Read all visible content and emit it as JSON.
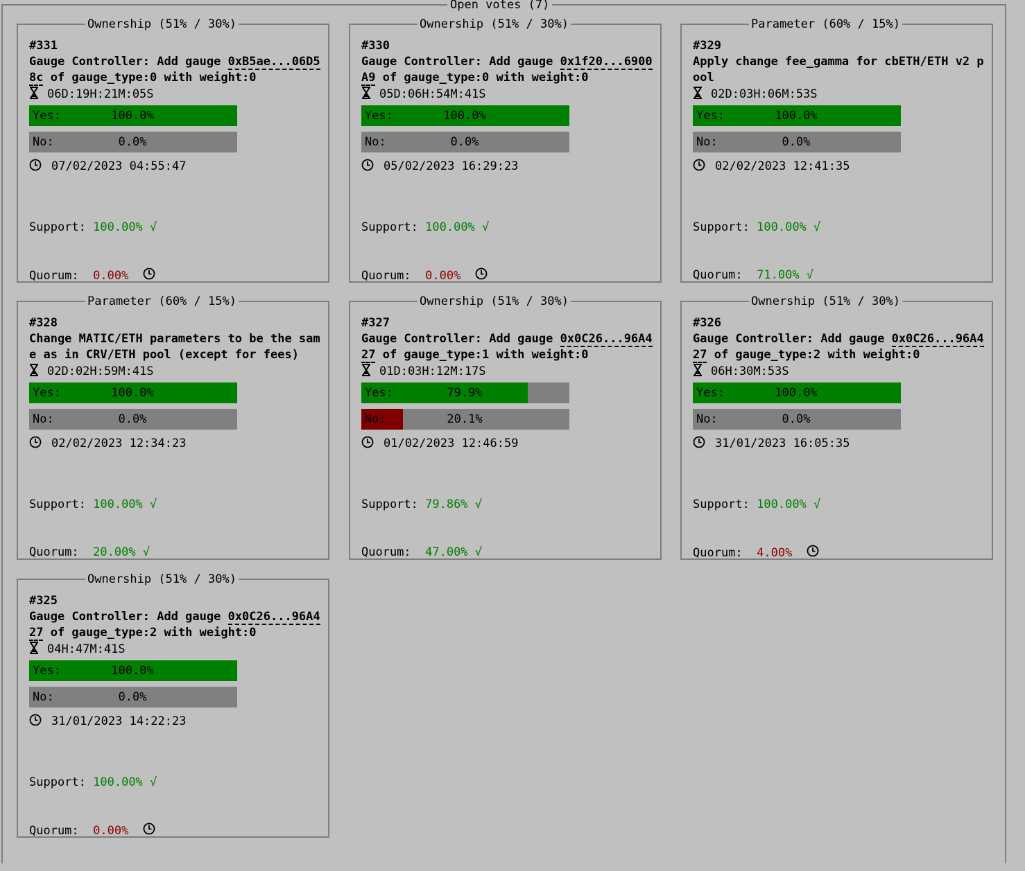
{
  "header": {
    "title": "Open votes (7)"
  },
  "colors": {
    "green": "#008000",
    "grey_bar": "#808080",
    "red": "#800000",
    "ok_text": "#008000",
    "fail_text": "#8b0000",
    "background": "#c0c0c0"
  },
  "votes": [
    {
      "type_label": "Ownership (51% / 30%)",
      "number": "#331",
      "desc_pre": "Gauge Controller: Add gauge ",
      "address": "0xB5ae...06D58c",
      "desc_post": " of gauge_type:0 with weight:0",
      "timer": "06D:19H:21M:05S",
      "yes_label": "Yes:",
      "yes_pct": "100.0%",
      "yes_fraction": 1.0,
      "no_label": "No:",
      "no_pct": "0.0%",
      "no_fraction": 0.0,
      "date": "07/02/2023 04:55:47",
      "support_label": "Support:",
      "support_value": "100.00% √",
      "support_ok": true,
      "quorum_label": "Quorum:",
      "quorum_value": "0.00%",
      "quorum_ok": false
    },
    {
      "type_label": "Ownership (51% / 30%)",
      "number": "#330",
      "desc_pre": "Gauge Controller: Add gauge ",
      "address": "0x1f20...6900A9",
      "desc_post": " of gauge_type:0 with weight:0",
      "timer": "05D:06H:54M:41S",
      "yes_label": "Yes:",
      "yes_pct": "100.0%",
      "yes_fraction": 1.0,
      "no_label": "No:",
      "no_pct": "0.0%",
      "no_fraction": 0.0,
      "date": "05/02/2023 16:29:23",
      "support_label": "Support:",
      "support_value": "100.00% √",
      "support_ok": true,
      "quorum_label": "Quorum:",
      "quorum_value": "0.00%",
      "quorum_ok": false
    },
    {
      "type_label": "Parameter (60% / 15%)",
      "number": "#329",
      "desc_pre": "Apply change fee_gamma for cbETH/ETH v2 pool",
      "address": "",
      "desc_post": "",
      "timer": "02D:03H:06M:53S",
      "yes_label": "Yes:",
      "yes_pct": "100.0%",
      "yes_fraction": 1.0,
      "no_label": "No:",
      "no_pct": "0.0%",
      "no_fraction": 0.0,
      "date": "02/02/2023 12:41:35",
      "support_label": "Support:",
      "support_value": "100.00% √",
      "support_ok": true,
      "quorum_label": "Quorum:",
      "quorum_value": "71.00% √",
      "quorum_ok": true
    },
    {
      "type_label": "Parameter (60% / 15%)",
      "number": "#328",
      "desc_pre": "Change MATIC/ETH parameters to be the same as in CRV/ETH pool (except for fees)",
      "address": "",
      "desc_post": "",
      "timer": "02D:02H:59M:41S",
      "yes_label": "Yes:",
      "yes_pct": "100.0%",
      "yes_fraction": 1.0,
      "no_label": "No:",
      "no_pct": "0.0%",
      "no_fraction": 0.0,
      "date": "02/02/2023 12:34:23",
      "support_label": "Support:",
      "support_value": "100.00% √",
      "support_ok": true,
      "quorum_label": "Quorum:",
      "quorum_value": "20.00% √",
      "quorum_ok": true
    },
    {
      "type_label": "Ownership (51% / 30%)",
      "number": "#327",
      "desc_pre": "Gauge Controller: Add gauge ",
      "address": "0x0C26...96A427",
      "desc_post": " of gauge_type:1 with weight:0",
      "timer": "01D:03H:12M:17S",
      "yes_label": "Yes:",
      "yes_pct": "79.9%",
      "yes_fraction": 0.799,
      "no_label": "No:",
      "no_pct": "20.1%",
      "no_fraction": 0.201,
      "date": "01/02/2023 12:46:59",
      "support_label": "Support:",
      "support_value": "79.86% √",
      "support_ok": true,
      "quorum_label": "Quorum:",
      "quorum_value": "47.00% √",
      "quorum_ok": true
    },
    {
      "type_label": "Ownership (51% / 30%)",
      "number": "#326",
      "desc_pre": "Gauge Controller: Add gauge ",
      "address": "0x0C26...96A427",
      "desc_post": " of gauge_type:2 with weight:0",
      "timer": "06H:30M:53S",
      "yes_label": "Yes:",
      "yes_pct": "100.0%",
      "yes_fraction": 1.0,
      "no_label": "No:",
      "no_pct": "0.0%",
      "no_fraction": 0.0,
      "date": "31/01/2023 16:05:35",
      "support_label": "Support:",
      "support_value": "100.00% √",
      "support_ok": true,
      "quorum_label": "Quorum:",
      "quorum_value": "4.00%",
      "quorum_ok": false
    },
    {
      "type_label": "Ownership (51% / 30%)",
      "number": "#325",
      "desc_pre": "Gauge Controller: Add gauge ",
      "address": "0x0C26...96A427",
      "desc_post": " of gauge_type:2 with weight:0",
      "timer": "04H:47M:41S",
      "yes_label": "Yes:",
      "yes_pct": "100.0%",
      "yes_fraction": 1.0,
      "no_label": "No:",
      "no_pct": "0.0%",
      "no_fraction": 0.0,
      "date": "31/01/2023 14:22:23",
      "support_label": "Support:",
      "support_value": "100.00% √",
      "support_ok": true,
      "quorum_label": "Quorum:",
      "quorum_value": "0.00%",
      "quorum_ok": false
    }
  ]
}
